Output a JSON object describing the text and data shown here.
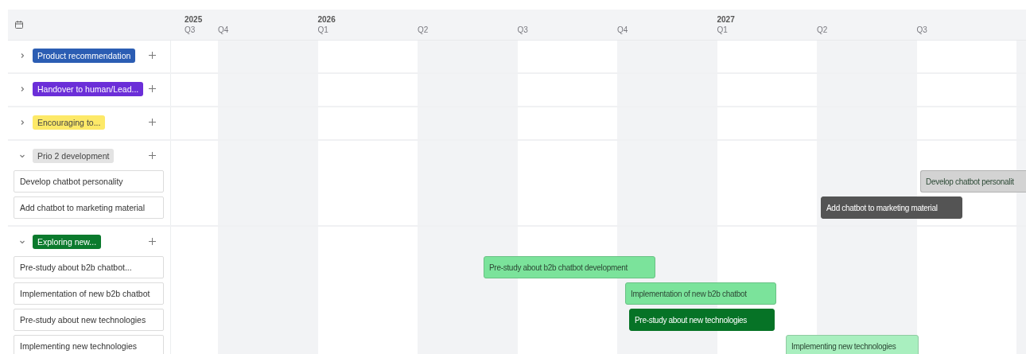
{
  "header": {
    "quarters": [
      {
        "year": "2025",
        "label": "Q3"
      },
      {
        "label": "Q4"
      },
      {
        "year": "2026",
        "label": "Q1"
      },
      {
        "label": "Q2"
      },
      {
        "label": "Q3"
      },
      {
        "label": "Q4"
      },
      {
        "year": "2027",
        "label": "Q1"
      },
      {
        "label": "Q2"
      },
      {
        "label": "Q3"
      }
    ]
  },
  "groups": [
    {
      "label": "Product recommendation",
      "color": "#2b5db3",
      "expanded": false
    },
    {
      "label": "Handover to human/Lead...",
      "color": "#6b2ed8",
      "expanded": false
    },
    {
      "label": "Encouraging to...",
      "color": "#fde968",
      "expanded": false
    },
    {
      "label": "Prio 2 development",
      "color": "#e3e3e3",
      "expanded": true,
      "items": [
        {
          "label": "Develop chatbot personality",
          "bar": {
            "label": "Develop chatbot personalit",
            "color": "#d3d3d3"
          }
        },
        {
          "label": "Add chatbot to marketing material",
          "bar": {
            "label": "Add chatbot to marketing material",
            "color": "#545454"
          }
        }
      ]
    },
    {
      "label": "Exploring new...",
      "color": "#0b7a2d",
      "expanded": true,
      "items": [
        {
          "label": "Pre-study about b2b chatbot...",
          "bar": {
            "label": "Pre-study about b2b chatbot development",
            "color": "#7be39b"
          }
        },
        {
          "label": "Implementation of new b2b chatbot",
          "bar": {
            "label": "Implementation of new b2b chatbot",
            "color": "#7be39b"
          }
        },
        {
          "label": "Pre-study about new technologies",
          "bar": {
            "label": "Pre-study about new technologies",
            "color": "#067326"
          }
        },
        {
          "label": "Implementing new technologies",
          "bar": {
            "label": "Implementing new technologies",
            "color": "#a9efbf"
          }
        }
      ]
    }
  ]
}
